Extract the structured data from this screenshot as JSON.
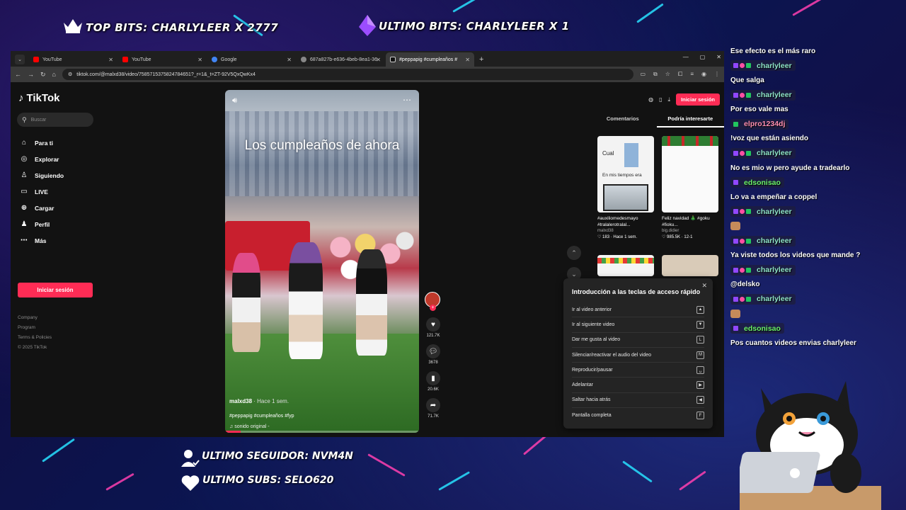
{
  "overlay": {
    "top_bits": "TOP BITS: CHARLYLEER X 2777",
    "ultimo_bits": "ULTIMO BITS: CHARLYLEER X 1",
    "ultimo_seguidor": "ULTIMO SEGUIDOR: NVM4N",
    "ultimo_subs": "ULTIMO SUBS: SELO620"
  },
  "browser": {
    "tabs": [
      {
        "label": "YouTube",
        "favicon_color": "#ff0000"
      },
      {
        "label": "YouTube",
        "favicon_color": "#ff0000"
      },
      {
        "label": "Google",
        "favicon_color": "#4285f4"
      },
      {
        "label": "687a827b-e636-4beb-8ea1-36",
        "favicon_color": "#888888"
      },
      {
        "label": "#peppapig #cumpleaños #",
        "favicon_color": "#ffffff"
      }
    ],
    "active_tab_index": 4,
    "url": "tiktok.com/@malxd38/video/7585715375824784651?_r=1&_t=ZT-92V5QxQwKx4"
  },
  "tiktok": {
    "logo": "TikTok",
    "search_placeholder": "Buscar",
    "nav": [
      {
        "label": "Para ti",
        "icon": "home-icon"
      },
      {
        "label": "Explorar",
        "icon": "compass-icon"
      },
      {
        "label": "Siguiendo",
        "icon": "following-icon"
      },
      {
        "label": "LIVE",
        "icon": "live-icon"
      },
      {
        "label": "Cargar",
        "icon": "upload-icon"
      },
      {
        "label": "Perfil",
        "icon": "profile-icon"
      },
      {
        "label": "Más",
        "icon": "more-icon"
      }
    ],
    "login_button": "Iniciar sesión",
    "footer": [
      "Company",
      "Program",
      "Terms & Policies",
      "© 2025 TikTok"
    ],
    "video": {
      "title": "Los cumpleaños de ahora",
      "username": "malxd38",
      "time": " · Hace 1 sem.",
      "tags": "#peppapig #cumpleaños #fyp",
      "music": "♫  sonido original -",
      "progress": 0.08
    },
    "actions": {
      "likes": "121.7K",
      "comments": "3678",
      "saves": "20.6K",
      "shares": "71.7K"
    },
    "right_panel": {
      "login": "Iniciar sesión",
      "tab_comments": "Comentarios",
      "tab_interest": "Podría interesarte",
      "cards": [
        {
          "caption": "#auxiliomedesmayo #tralalerotralal...",
          "author": "malxd38",
          "meta": "♡ 183 · Hace 1 sem.",
          "thumb_text_1": "Cual",
          "thumb_text_2": "En mis tiempos era"
        },
        {
          "caption": "Feliz navidad 🎄 #goku #fioku...",
          "author": "big.didier",
          "meta": "♡ 985.5K · 12-1"
        }
      ]
    },
    "shortcuts": {
      "title": "Introducción a las teclas de acceso rápido",
      "items": [
        {
          "label": "Ir al video anterior",
          "key": "▲"
        },
        {
          "label": "Ir al siguiente video",
          "key": "▼"
        },
        {
          "label": "Dar me gusta al video",
          "key": "L"
        },
        {
          "label": "Silenciar/reactivar el audio del video",
          "key": "M"
        },
        {
          "label": "Reproducir/pausar",
          "key": "␣"
        },
        {
          "label": "Adelantar",
          "key": "▶"
        },
        {
          "label": "Saltar hacia atrás",
          "key": "◀"
        },
        {
          "label": "Pantalla completa",
          "key": "F"
        }
      ]
    }
  },
  "chat": [
    {
      "type": "msg",
      "text": "Ese efecto es el más raro"
    },
    {
      "type": "user",
      "name": "charlyleer",
      "color": "#8ee3c8",
      "badges": 3
    },
    {
      "type": "msg",
      "text": "Que salga"
    },
    {
      "type": "user",
      "name": "charlyleer",
      "color": "#8ee3c8",
      "badges": 3
    },
    {
      "type": "msg",
      "text": "Por eso vale mas"
    },
    {
      "type": "user",
      "name": "elpro1234dj",
      "color": "#ff8fb1",
      "badges": 1
    },
    {
      "type": "msg",
      "text": "!voz que están asiendo"
    },
    {
      "type": "user",
      "name": "charlyleer",
      "color": "#8ee3c8",
      "badges": 3
    },
    {
      "type": "msg",
      "text": "No es mio w pero ayude a tradearlo"
    },
    {
      "type": "user",
      "name": "edsonisao",
      "color": "#6bf26b",
      "badges": 1
    },
    {
      "type": "msg",
      "text": "Lo va a empeñar a coppel"
    },
    {
      "type": "user",
      "name": "charlyleer",
      "color": "#8ee3c8",
      "badges": 3
    },
    {
      "type": "emote",
      "text": ""
    },
    {
      "type": "user",
      "name": "charlyleer",
      "color": "#8ee3c8",
      "badges": 3
    },
    {
      "type": "msg",
      "text": "Ya viste todos los videos que mande ?"
    },
    {
      "type": "user",
      "name": "charlyleer",
      "color": "#8ee3c8",
      "badges": 3
    },
    {
      "type": "msg",
      "text": "@delsko"
    },
    {
      "type": "user",
      "name": "charlyleer",
      "color": "#8ee3c8",
      "badges": 3
    },
    {
      "type": "emote",
      "text": ""
    },
    {
      "type": "user",
      "name": "edsonisao",
      "color": "#6bf26b",
      "badges": 1
    },
    {
      "type": "msg",
      "text": "Pos cuantos videos envias charlyleer"
    }
  ]
}
